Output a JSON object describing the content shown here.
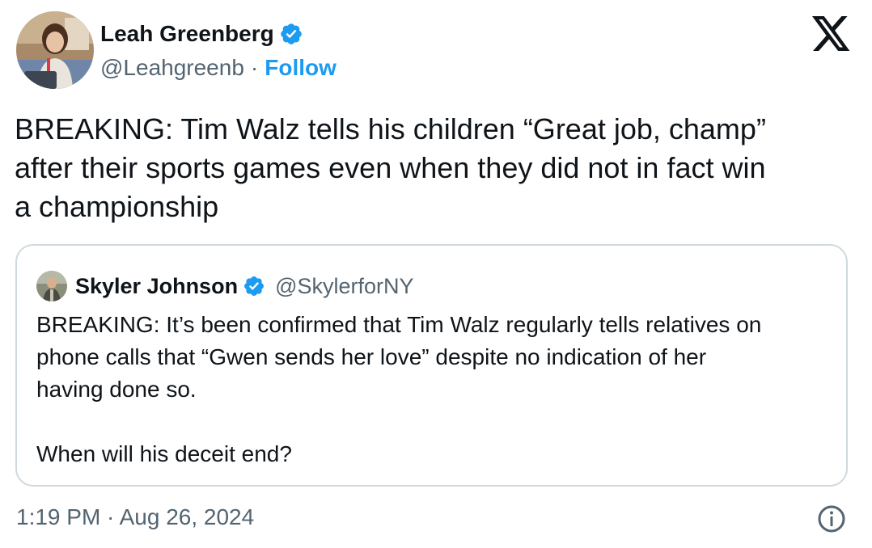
{
  "author": {
    "name": "Leah Greenberg",
    "handle": "@Leahgreenb",
    "separator": "·",
    "follow_label": "Follow",
    "avatar_icon": "avatar-photo",
    "verified_icon": "verified-badge-icon"
  },
  "tweet": {
    "text": "BREAKING: Tim Walz tells his children “Great job, champ”\nafter their sports games even when they did not in fact win\na championship"
  },
  "quoted_tweet": {
    "author_name": "Skyler Johnson",
    "handle": "@SkylerforNY",
    "text": "BREAKING: It’s been confirmed that Tim Walz regularly tells relatives on\nphone calls that “Gwen sends her love” despite no indication of her\nhaving done so.\n\nWhen will his deceit end?"
  },
  "footer": {
    "timestamp": "1:19 PM · Aug 26, 2024",
    "info_icon": "info-icon"
  },
  "colors": {
    "text": "#0f1419",
    "secondary": "#536471",
    "accent": "#1d9bf0",
    "border": "#cfd9de"
  }
}
